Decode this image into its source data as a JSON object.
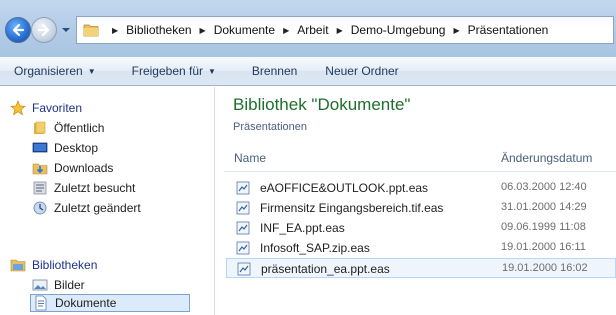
{
  "address_bar": {
    "breadcrumbs": [
      "Bibliotheken",
      "Dokumente",
      "Arbeit",
      "Demo-Umgebung",
      "Präsentationen"
    ]
  },
  "toolbar": {
    "organize_label": "Organisieren",
    "share_label": "Freigeben für",
    "burn_label": "Brennen",
    "new_folder_label": "Neuer Ordner"
  },
  "nav": {
    "favorites": {
      "label": "Favoriten",
      "items": [
        "Öffentlich",
        "Desktop",
        "Downloads",
        "Zuletzt besucht",
        "Zuletzt geändert"
      ]
    },
    "libraries": {
      "label": "Bibliotheken",
      "items": [
        "Bilder",
        "Dokumente"
      ],
      "selected": "Dokumente"
    }
  },
  "content": {
    "title": "Bibliothek \"Dokumente\"",
    "subtitle": "Präsentationen",
    "columns": {
      "name": "Name",
      "date": "Änderungsdatum"
    },
    "files": [
      {
        "name": "eAOFFICE&OUTLOOK.ppt.eas",
        "date": "06.03.2000 12:40"
      },
      {
        "name": "Firmensitz Eingangsbereich.tif.eas",
        "date": "31.01.2000 14:29"
      },
      {
        "name": "INF_EA.ppt.eas",
        "date": "09.06.1999 11:08"
      },
      {
        "name": "Infosoft_SAP.zip.eas",
        "date": "19.01.2000 16:11"
      },
      {
        "name": "präsentation_ea.ppt.eas",
        "date": "19.01.2000 16:02"
      }
    ],
    "selected_file_index": 4
  },
  "colors": {
    "title_green": "#1e6f2e",
    "selection_blue": "#dcebfc",
    "toolbar_text": "#1e395b"
  },
  "icons": {
    "back": "back-arrow-icon",
    "forward": "forward-arrow-icon",
    "folder": "folder-icon",
    "star": "star-icon",
    "file": "eas-file-icon"
  }
}
